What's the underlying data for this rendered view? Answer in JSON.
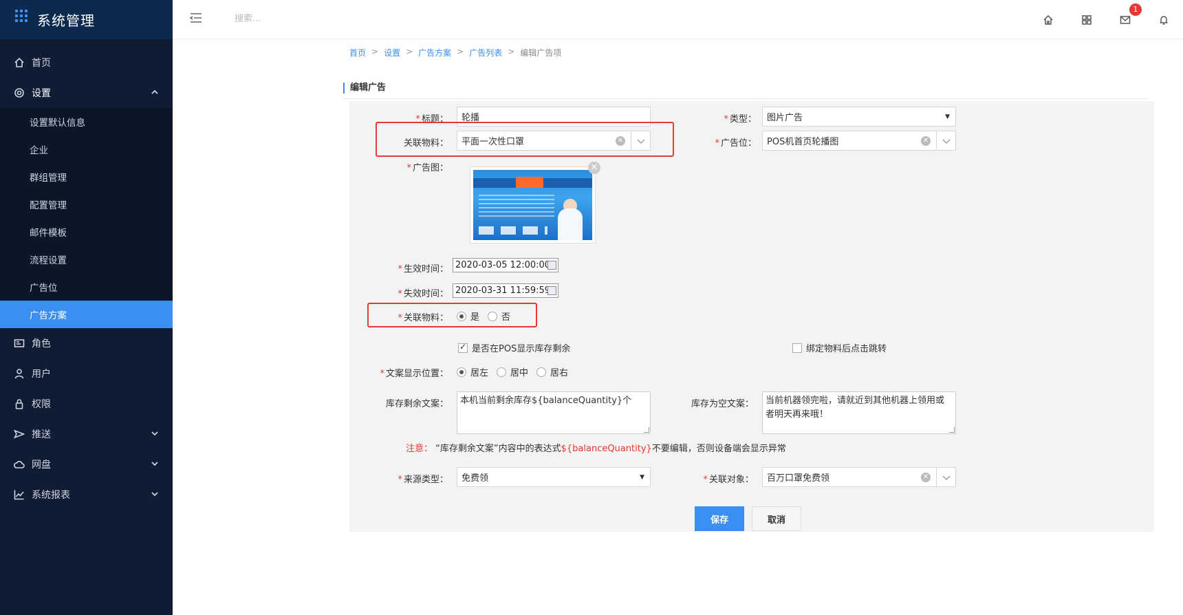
{
  "brand": {
    "title": "系统管理"
  },
  "topbar": {
    "search_placeholder": "搜索...",
    "mail_badge": "1"
  },
  "nav": {
    "home": "首页",
    "settings": "设置",
    "settings_sub": [
      "设置默认信息",
      "企业",
      "群组管理",
      "配置管理",
      "邮件模板",
      "流程设置",
      "广告位",
      "广告方案"
    ],
    "role": "角色",
    "user": "用户",
    "permission": "权限",
    "push": "推送",
    "netdisk": "网盘",
    "report": "系统报表"
  },
  "breadcrumb": {
    "home": "首页",
    "settings": "设置",
    "ad_plan": "广告方案",
    "ad_list": "广告列表",
    "current": "编辑广告项",
    "sep": ">"
  },
  "section": {
    "title": "编辑广告"
  },
  "form": {
    "req": "*",
    "title_label": "标题：",
    "title_value": "轮播",
    "type_label": "类型：",
    "type_value": "图片广告",
    "material_label": "关联物料：",
    "material_value": "平面一次性口罩",
    "slot_label": "广告位：",
    "slot_value": "POS机首页轮播图",
    "image_label": "广告图：",
    "start_label": "生效时间：",
    "start_value": "2020-03-05 12:00:00",
    "end_label": "失效时间：",
    "end_value": "2020-03-31 11:59:59",
    "link_material_label": "关联物料：",
    "yes": "是",
    "no": "否",
    "show_stock_label": "是否在POS显示库存剩余",
    "bind_jump_label": "绑定物料后点击跳转",
    "copy_pos_label": "文案显示位置：",
    "pos_left": "居左",
    "pos_center": "居中",
    "pos_right": "居右",
    "stock_copy_label": "库存剩余文案：",
    "stock_copy_value": "本机当前剩余库存${balanceQuantity}个",
    "empty_copy_label": "库存为空文案：",
    "empty_copy_value": "当前机器领完啦，请就近到其他机器上领用或者明天再来哦！",
    "note_prefix": "注意：",
    "note_text_1": "“库存剩余文案”内容中的表达式",
    "note_expr": "${balanceQuantity}",
    "note_text_2": "不要编辑，否则设备端会显示异常",
    "source_label": "来源类型：",
    "source_value": "免费领",
    "target_label": "关联对象：",
    "target_value": "百万口罩免费领",
    "save": "保存",
    "cancel": "取消"
  },
  "colors": {
    "accent": "#3a8ff0",
    "sidebar_bg": "#0f1c33",
    "highlight": "#e53935"
  }
}
